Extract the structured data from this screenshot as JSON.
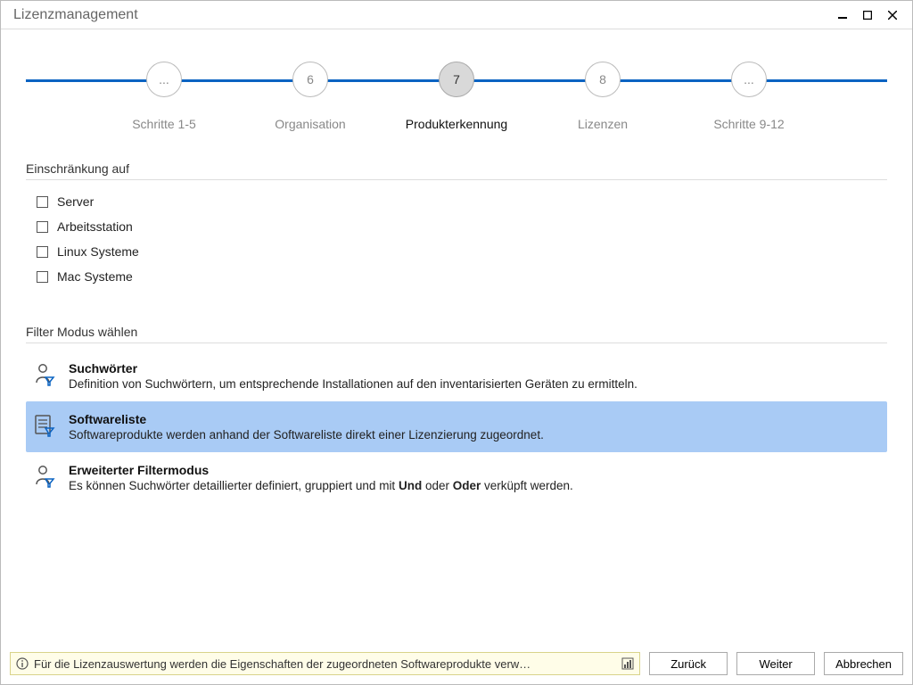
{
  "window": {
    "title": "Lizenzmanagement"
  },
  "stepper": {
    "nodes": [
      {
        "num": "...",
        "label": "Schritte 1-5",
        "active": false
      },
      {
        "num": "6",
        "label": "Organisation",
        "active": false
      },
      {
        "num": "7",
        "label": "Produkterkennung",
        "active": true
      },
      {
        "num": "8",
        "label": "Lizenzen",
        "active": false
      },
      {
        "num": "...",
        "label": "Schritte 9-12",
        "active": false
      }
    ]
  },
  "restriction": {
    "title": "Einschränkung auf",
    "items": [
      {
        "label": "Server"
      },
      {
        "label": "Arbeitsstation"
      },
      {
        "label": "Linux Systeme"
      },
      {
        "label": "Mac Systeme"
      }
    ]
  },
  "filterMode": {
    "title": "Filter Modus wählen",
    "options": [
      {
        "title": "Suchwörter",
        "desc_pre": "Definition von Suchwörtern, um entsprechende Installationen auf den inventarisierten Geräten zu ermitteln.",
        "selected": false,
        "icon": "person-filter"
      },
      {
        "title": "Softwareliste",
        "desc_pre": "Softwareprodukte werden anhand der Softwareliste direkt einer Lizenzierung zugeordnet.",
        "selected": true,
        "icon": "list-filter"
      },
      {
        "title": "Erweiterter Filtermodus",
        "desc_pre": "Es können Suchwörter detaillierter definiert, gruppiert und mit ",
        "bold1": "Und",
        "mid": " oder ",
        "bold2": "Oder",
        "desc_post": " verküpft werden.",
        "selected": false,
        "icon": "person-filter"
      }
    ]
  },
  "footer": {
    "info": "Für die Lizenzauswertung werden die Eigenschaften der zugeordneten Softwareprodukte verw…",
    "back": "Zurück",
    "next": "Weiter",
    "cancel": "Abbrechen"
  }
}
